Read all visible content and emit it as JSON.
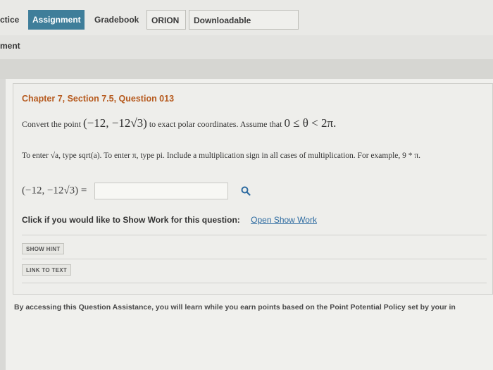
{
  "tabs": [
    {
      "label": "ctice"
    },
    {
      "label": "Assignment"
    },
    {
      "label": "Gradebook"
    },
    {
      "label": "ORION"
    },
    {
      "label": "Downloadable eTextbook"
    }
  ],
  "breadcrumb": "ment",
  "question": {
    "title": "Chapter 7, Section 7.5, Question 013",
    "prompt_pre": "Convert the point",
    "point": "(−12, −12√3)",
    "prompt_post": "to exact polar coordinates. Assume that",
    "condition": "0 ≤ θ < 2π.",
    "hint_line": "To enter √a, type sqrt(a). To enter π, type pi. Include a multiplication sign in all cases of multiplication. For example, 9 * π.",
    "answer_label": "(−12, −12√3) =",
    "answer_value": ""
  },
  "show_work": {
    "label": "Click if you would like to Show Work for this question:",
    "link": "Open Show Work"
  },
  "buttons": {
    "hint": "SHOW HINT",
    "link_to_text": "LINK TO TEXT"
  },
  "footer": "By accessing this Question Assistance, you will learn while you earn points based on the Point Potential Policy set by your in",
  "colors": {
    "active_tab": "#3f7e9a",
    "title": "#b65a1e",
    "link": "#2c6aa0"
  }
}
